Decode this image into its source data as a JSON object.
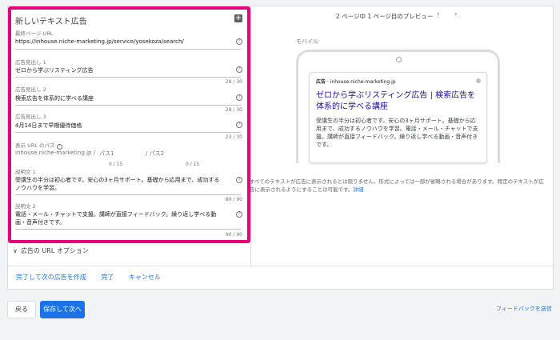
{
  "form": {
    "title": "新しいテキスト広告",
    "final_url": {
      "label": "最終ページ URL",
      "value": "https://inhouse.niche-marketing.jp/service/yosekoza/search/"
    },
    "headline1": {
      "label": "広告見出し 1",
      "value": "ゼロから学ぶリスティング広告",
      "count": "28 / 30"
    },
    "headline2": {
      "label": "広告見出し 2",
      "value": "検索広告を体系的に学べる講座",
      "count": "28 / 30"
    },
    "headline3": {
      "label": "広告見出し 3",
      "value": "4月14日まで早期優待価格",
      "count": "23 / 30"
    },
    "display_path": {
      "label": "表示 URL のパス",
      "base": "inhouse.niche-marketing.jp /",
      "path1_placeholder": "パス1",
      "path2_placeholder": "/ パス2",
      "count1": "0 / 15",
      "count2": "0 / 15"
    },
    "desc1": {
      "label": "説明文 1",
      "value": "受講生の半分は初心者です。安心の3ヶ月サポート。基礎から応用まで、成功するノウハウを学習。",
      "count": "89 / 90"
    },
    "desc2": {
      "label": "説明文 2",
      "value": "電話・メール・チャットで支援。講師が直接フィードバック。繰り返し学べる動画・音声付きです。",
      "count": "90 / 90"
    },
    "url_options": "広告の URL オプション"
  },
  "footer_links": {
    "create_next": "完了して次の広告を作成",
    "done": "完了",
    "cancel": "キャンセル"
  },
  "preview": {
    "page_info": "2 ページ中 1 ページ目のプレビュー",
    "device_label": "モバイル",
    "ad_badge": "広告",
    "ad_domain": "· inhouse.niche-marketing.jp",
    "ad_headline": "ゼロから学ぶリスティング広告 | 検索広告を体系的に学べる講座",
    "ad_description": "受講生の半分は初心者です。安心の3ヶ月サポート。基礎から応用まで、成功するノウハウを学習。電話・メール・チャットで支援。講師が直接フィードバック。繰り返し学べる動画・音声付きです。",
    "note": "すべてのテキストが広告に表示されるとは限りません。形式によっては一部が省略される場合があります。特定のテキストが広告に表示されるようにすることは可能です。",
    "note_link": "詳細"
  },
  "bottom": {
    "back": "戻る",
    "save_next": "保存して次へ",
    "feedback": "フィードバックを送信"
  },
  "colors": {
    "highlight": "#e3057e",
    "primary": "#1a73e8",
    "link": "#1a0dab"
  }
}
